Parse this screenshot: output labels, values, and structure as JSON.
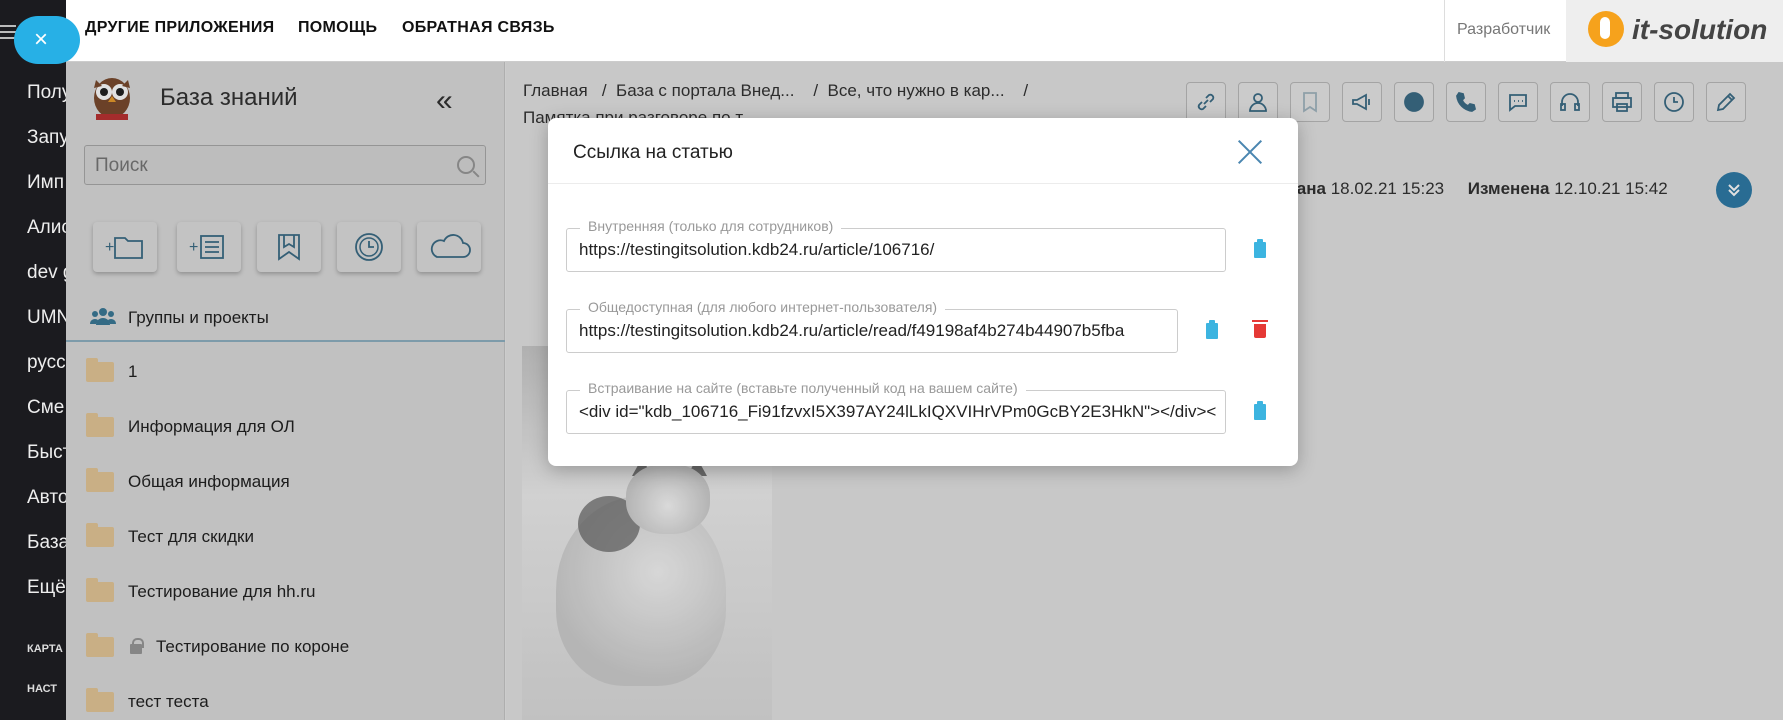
{
  "left_strip": {
    "items": [
      "Полу",
      "Запу",
      "Имп",
      "Алис",
      "dev g",
      "UMN",
      "русс",
      "Сме",
      "Быст",
      "Авто",
      "База",
      "Ещё"
    ],
    "small_items": [
      "КАРТА",
      "НАСТ"
    ]
  },
  "topbar": {
    "nav": [
      "ДРУГИЕ ПРИЛОЖЕНИЯ",
      "ПОМОЩЬ",
      "ОБРАТНАЯ СВЯЗЬ"
    ],
    "developer": "Разработчик",
    "logo_text": "it-solution",
    "close_glyph": "×"
  },
  "sidebar": {
    "title": "База знаний",
    "collapse_glyph": "«",
    "search_placeholder": "Поиск",
    "groups_label": "Группы и проекты",
    "folders": [
      {
        "label": "1"
      },
      {
        "label": "Информация для ОЛ"
      },
      {
        "label": "Общая информация"
      },
      {
        "label": "Тест для скидки"
      },
      {
        "label": "Тестирование для hh.ru"
      },
      {
        "label": "Тестирование по короне"
      },
      {
        "label": "тест теста"
      }
    ]
  },
  "breadcrumbs": {
    "line1": "Главная   /  База с портала Внед...    /  Все, что нужно в кар...    /",
    "line2": "Памятка при разговоре по т..."
  },
  "article": {
    "created_label": "дана",
    "created_value": "18.02.21 15:23",
    "modified_label": "Изменена",
    "modified_value": "12.10.21 15:42"
  },
  "modal": {
    "title": "Ссылка на статью",
    "fields": [
      {
        "label": "Внутренняя (только для сотрудников)",
        "value": "https://testingitsolution.kdb24.ru/article/106716/"
      },
      {
        "label": "Общедоступная (для любого интернет-пользователя)",
        "value": "https://testingitsolution.kdb24.ru/article/read/f49198af4b274b44907b5fba"
      },
      {
        "label": "Встраивание на сайте (вставьте полученный код на вашем сайте)",
        "value": "<div id=\"kdb_106716_Fi91fzvxI5X397AY24lLkIQXVIHrVPm0GcBY2E3HkN\"></div><"
      }
    ]
  }
}
